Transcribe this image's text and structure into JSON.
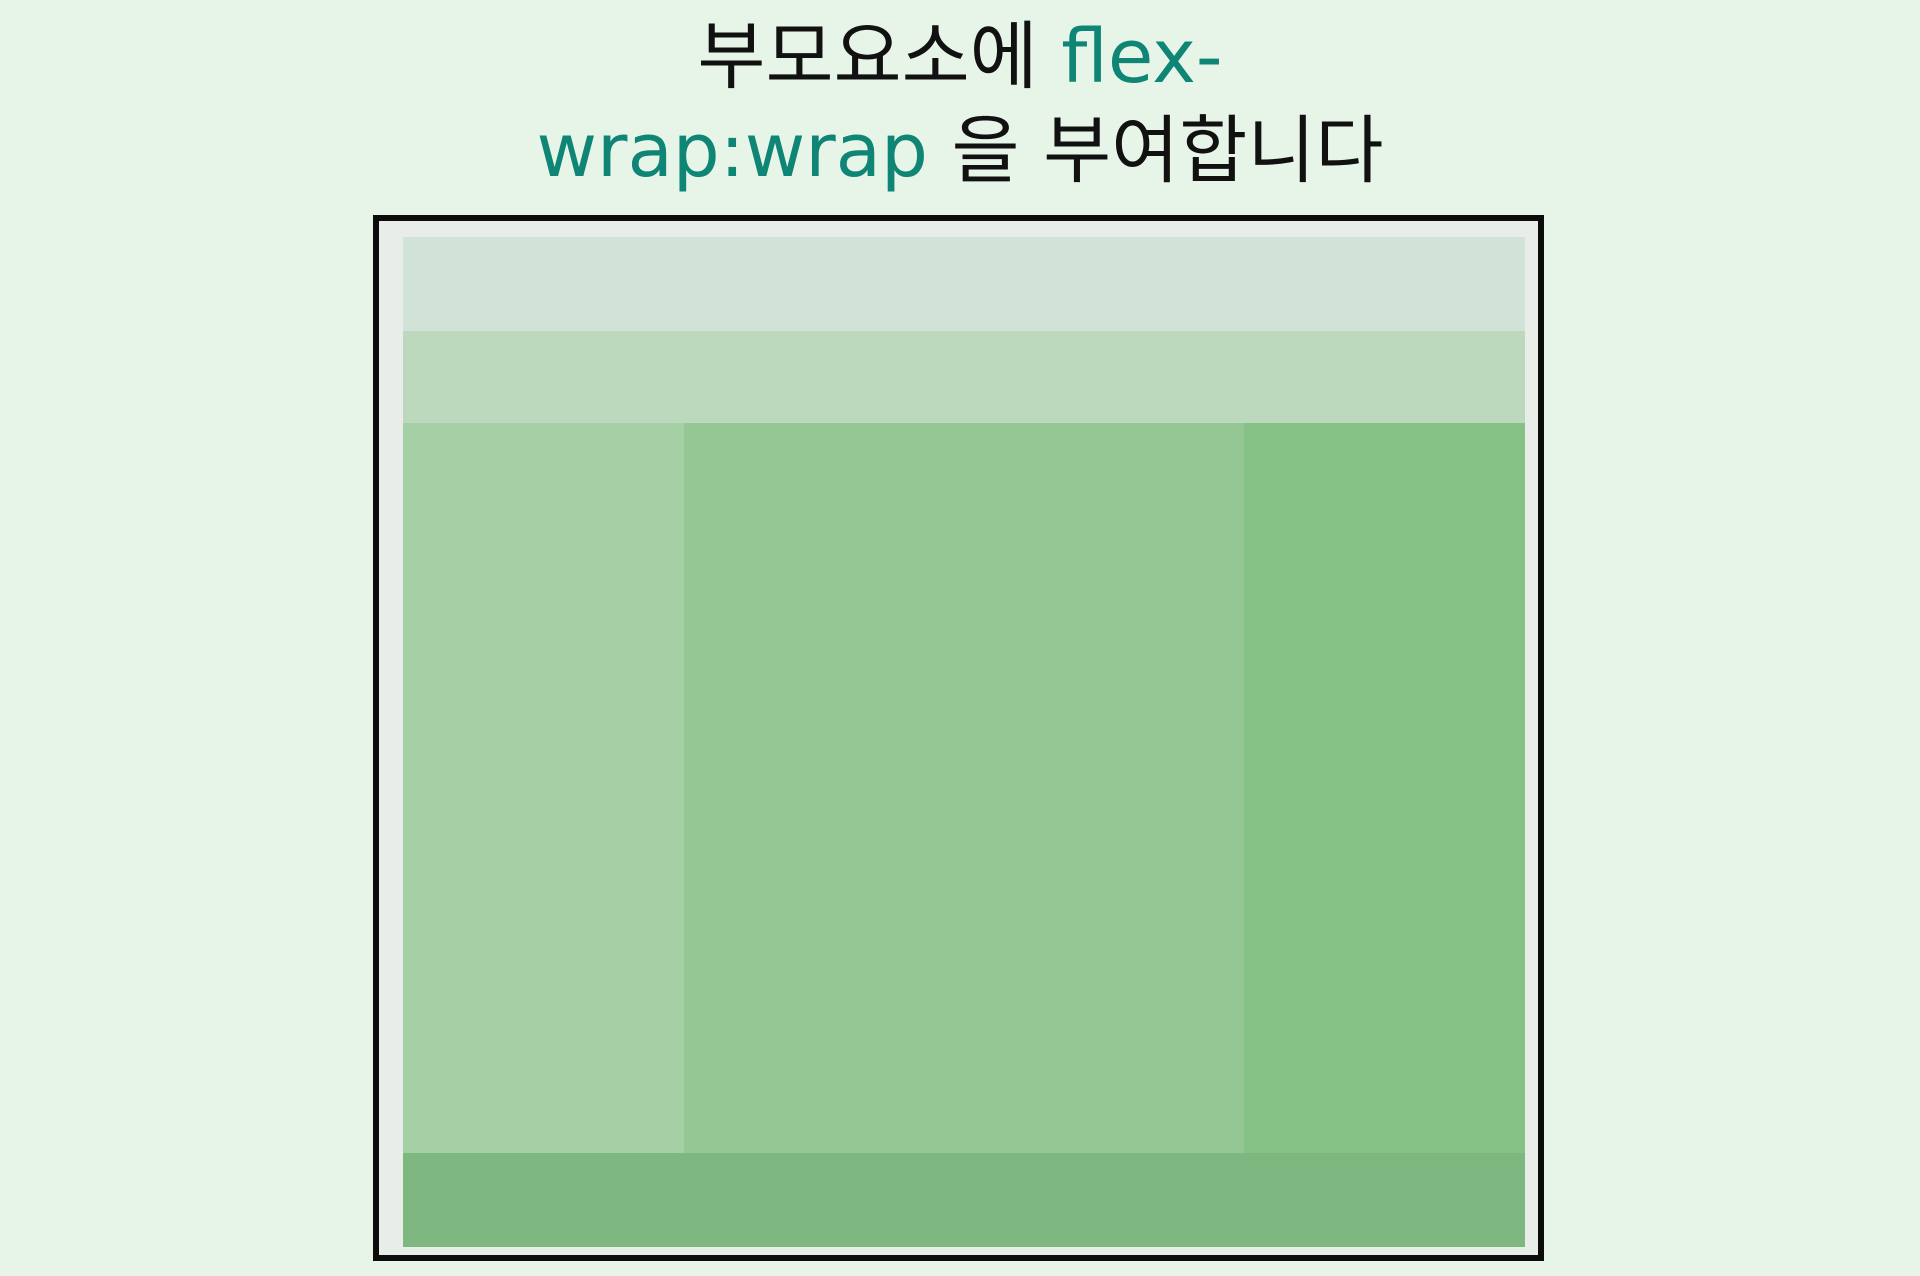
{
  "title": {
    "line1_text": "부모요소에 ",
    "code1": "flex-",
    "code2": "wrap:wrap",
    "line2_text": " 을 부여합니다"
  },
  "colors": {
    "background": "#e7f5e9",
    "accent_code": "#0f8575",
    "container_border": "#0c0c0c",
    "header": "#d0e3d6",
    "nav": "#bcd9bd",
    "left": "#a5cfa5",
    "main": "#95c795",
    "right": "#86c186",
    "footer": "#7fb780"
  }
}
